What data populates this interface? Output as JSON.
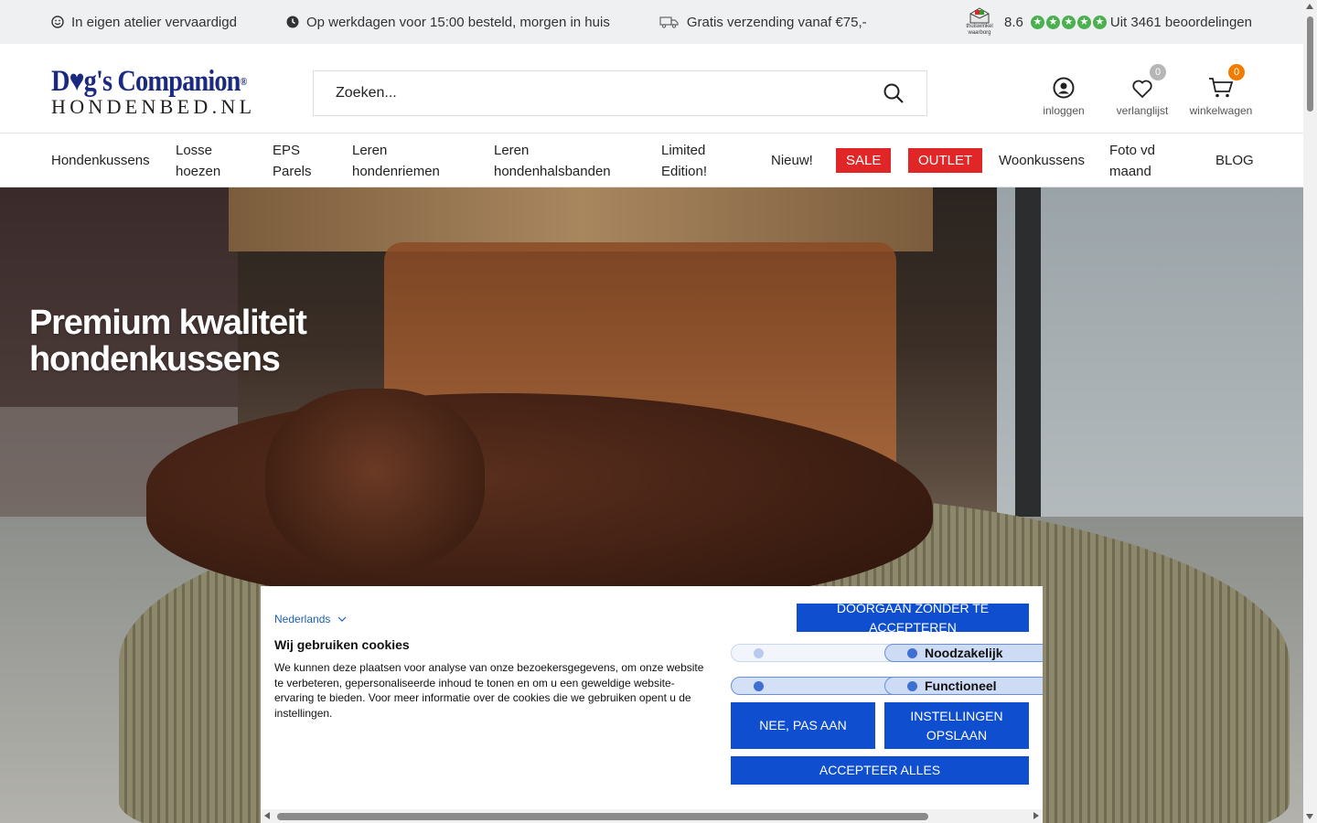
{
  "usp": {
    "items": [
      {
        "icon": "smiley-icon",
        "text": "In eigen atelier vervaardigd"
      },
      {
        "icon": "clock-icon",
        "text": "Op werkdagen voor 15:00 besteld, morgen in huis"
      },
      {
        "icon": "truck-icon",
        "text": "Gratis verzending vanaf €75,-"
      }
    ],
    "rating": {
      "badge_line1": "thuiswinkel",
      "badge_line2": "waarborg",
      "score": "8.6",
      "stars": 5,
      "reviews": "Uit 3461 beoordelingen",
      "star_color": "#4caf50"
    }
  },
  "header": {
    "logo_line1": "D♥g's Companion",
    "logo_reg": "®",
    "logo_line2": "HONDENBED.NL",
    "search_placeholder": "Zoeken...",
    "account_label": "inloggen",
    "wishlist_label": "verlanglijst",
    "wishlist_count": "0",
    "cart_label": "winkelwagen",
    "cart_count": "0"
  },
  "nav": {
    "items": [
      {
        "label": "Hondenkussens"
      },
      {
        "label": "Losse hoezen"
      },
      {
        "label": "EPS Parels"
      },
      {
        "label": "Leren hondenriemen"
      },
      {
        "label": "Leren hondenhalsbanden"
      },
      {
        "label": "Limited Edition!"
      },
      {
        "label": "Nieuw!"
      },
      {
        "label": "SALE"
      },
      {
        "label": "OUTLET"
      },
      {
        "label": "Woonkussens"
      },
      {
        "label": "Foto vd maand"
      },
      {
        "label": "BLOG"
      }
    ],
    "sale_color": "#e02626"
  },
  "hero": {
    "title_line1": "Premium kwaliteit",
    "title_line2": "hondenkussens"
  },
  "cookie": {
    "language": "Nederlands",
    "title": "Wij gebruiken cookies",
    "text": "We kunnen deze plaatsen voor analyse van onze bezoekersgegevens, om onze website te verbeteren, gepersonaliseerde inhoud te tonen en om u een geweldige website-ervaring te bieden. Voor meer informatie over de cookies die we gebruiken opent u de instellingen.",
    "continue_label": "DOORGAAN ZONDER TE ACCEPTEREN",
    "toggle_necessary": "Noodzakelijk",
    "toggle_functional": "Functioneel",
    "no_label": "NEE, PAS AAN",
    "save_label": "INSTELLINGEN OPSLAAN",
    "accept_label": "ACCEPTEER ALLES",
    "button_color": "#0f4fcf"
  }
}
